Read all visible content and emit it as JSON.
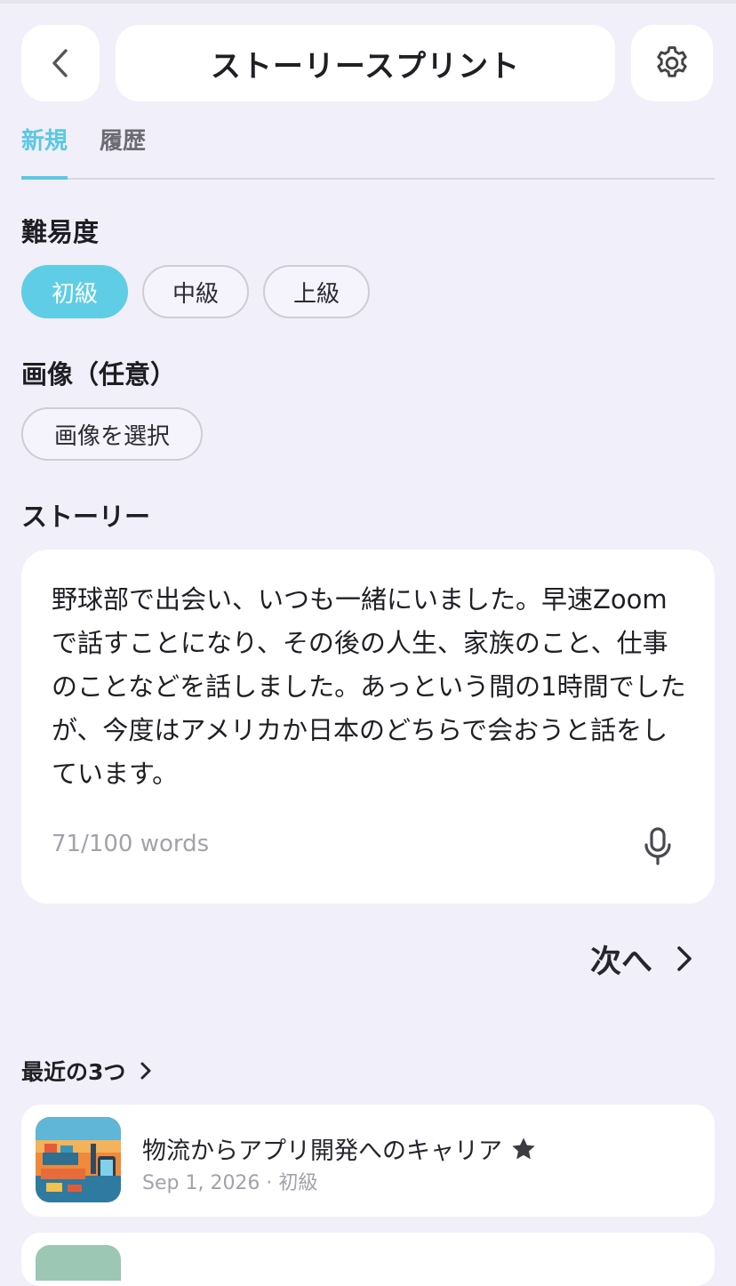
{
  "header": {
    "title": "ストーリースプリント",
    "back_icon": "chevron-left-icon",
    "settings_icon": "gear-icon"
  },
  "tabs": [
    {
      "label": "新規",
      "active": true
    },
    {
      "label": "履歴",
      "active": false
    }
  ],
  "difficulty": {
    "label": "難易度",
    "options": [
      {
        "label": "初級",
        "selected": true
      },
      {
        "label": "中級",
        "selected": false
      },
      {
        "label": "上級",
        "selected": false
      }
    ]
  },
  "image": {
    "label": "画像（任意）",
    "select_label": "画像を選択"
  },
  "story": {
    "label": "ストーリー",
    "text": "野球部で出会い、いつも一緒にいました。早速Zoomで話すことになり、その後の人生、家族のこと、仕事のことなどを話しました。あっという間の1時間でしたが、今度はアメリカか日本のどちらで会おうと話をしています。",
    "word_count": "71/100 words",
    "mic_icon": "microphone-icon"
  },
  "next_label": "次へ",
  "recent": {
    "label": "最近の3つ",
    "items": [
      {
        "title": "物流からアプリ開発へのキャリア",
        "meta": "Sep 1, 2026 · 初級",
        "starred": true
      }
    ]
  },
  "colors": {
    "accent": "#5fcde6",
    "background": "#f1eff9",
    "star": "#3c3b41"
  }
}
